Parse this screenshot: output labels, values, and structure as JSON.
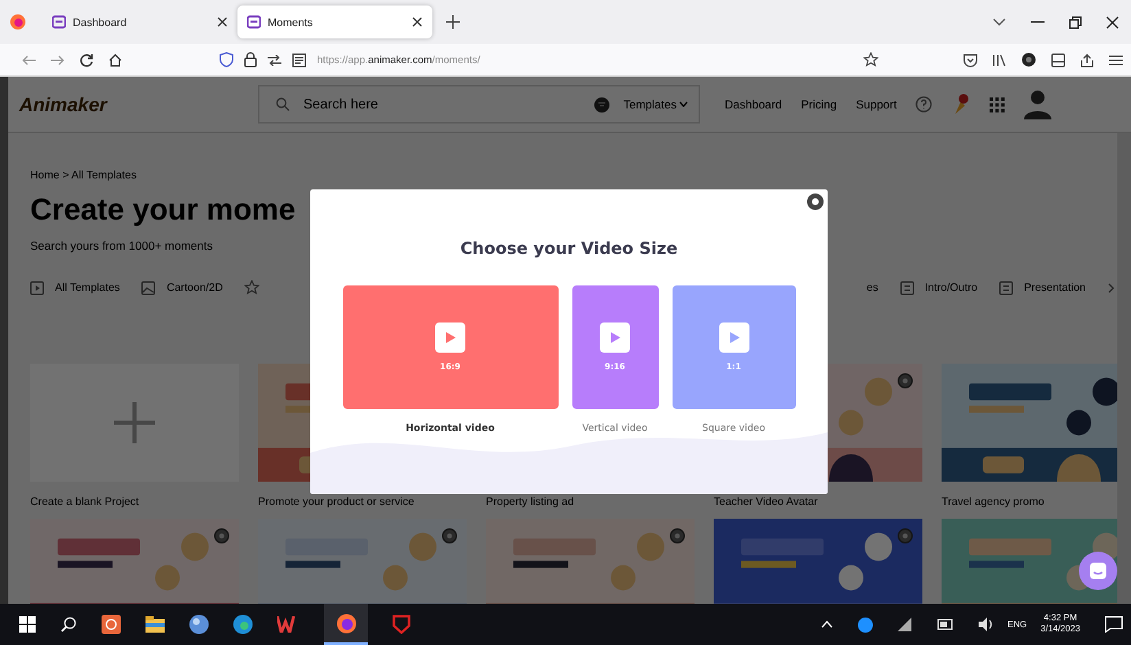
{
  "browser": {
    "tabs": [
      {
        "title": "Dashboard",
        "selected": false
      },
      {
        "title": "Moments",
        "selected": true
      }
    ],
    "url": {
      "scheme": "https://app.",
      "domain": "animaker.com",
      "path": "/moments/"
    }
  },
  "app_header": {
    "logo": "Animaker",
    "search": {
      "placeholder": "Search here"
    },
    "templates_menu": "Templates",
    "nav": [
      "Dashboard",
      "Pricing",
      "Support"
    ]
  },
  "page": {
    "breadcrumb": "Home > All Templates",
    "title": "Create your mome",
    "subtitle": "Search yours from 1000+ moments",
    "categories_left": [
      "All Templates",
      "Cartoon/2D"
    ],
    "categories_right": [
      "es",
      "Intro/Outro",
      "Presentation"
    ],
    "cards": [
      {
        "kind": "blank",
        "caption": "Create a blank Project"
      },
      {
        "kind": "picture",
        "caption": "Promote your product or service"
      },
      {
        "caption": "Property listing ad"
      },
      {
        "kind": "picture",
        "caption": "Teacher Video Avatar",
        "menu": true
      },
      {
        "kind": "picture",
        "caption": "Travel agency promo"
      },
      {
        "kind": "picture",
        "menu": true
      },
      {
        "kind": "picture",
        "menu": true
      },
      {
        "kind": "picture",
        "menu": true
      },
      {
        "kind": "picture",
        "menu": true
      },
      {
        "kind": "picture"
      }
    ]
  },
  "modal": {
    "title": "Choose your Video Size",
    "options": [
      {
        "kind": "horizontal",
        "ratio": "16:9",
        "label": "Horizontal video",
        "color": "#ff6f6f",
        "selected": true
      },
      {
        "kind": "vertical",
        "ratio": "9:16",
        "label": "Vertical video",
        "color": "#b77dfb",
        "selected": false
      },
      {
        "kind": "square",
        "ratio": "1:1",
        "label": "Square video",
        "color": "#98a5fd",
        "selected": false
      }
    ]
  },
  "taskbar": {
    "language": "ENG",
    "time": "4:32 PM",
    "date": "3/14/2023"
  }
}
